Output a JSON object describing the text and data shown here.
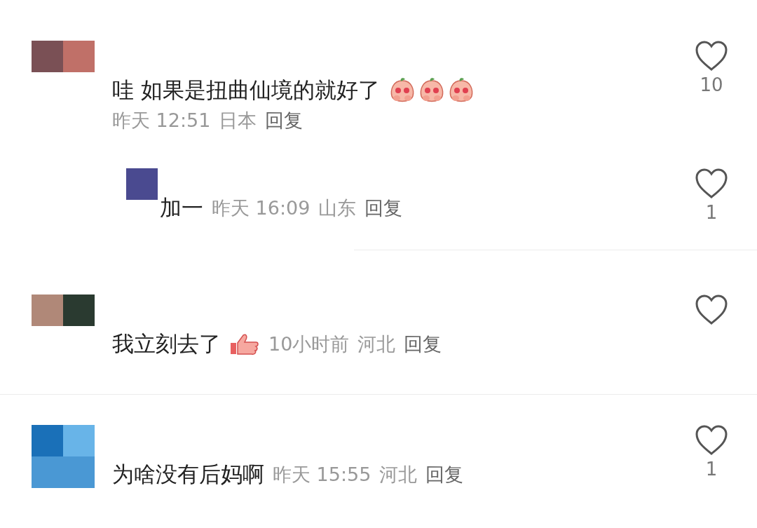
{
  "comments": [
    {
      "text": "哇 如果是扭曲仙境的就好了",
      "emojis": [
        {
          "kind": "peach"
        },
        {
          "kind": "peach"
        },
        {
          "kind": "peach"
        }
      ],
      "time": "昨天 12:51",
      "location": "日本",
      "reply_label": "回复",
      "likes": "10",
      "replies": [
        {
          "text": "加一",
          "time": "昨天 16:09",
          "location": "山东",
          "reply_label": "回复",
          "likes": "1"
        }
      ]
    },
    {
      "text": "我立刻去了",
      "emojis": [
        {
          "kind": "thumbs"
        }
      ],
      "time": "10小时前",
      "location": "河北",
      "reply_label": "回复"
    },
    {
      "text": "为啥没有后妈啊",
      "time": "昨天 15:55",
      "location": "河北",
      "reply_label": "回复",
      "likes": "1"
    }
  ]
}
